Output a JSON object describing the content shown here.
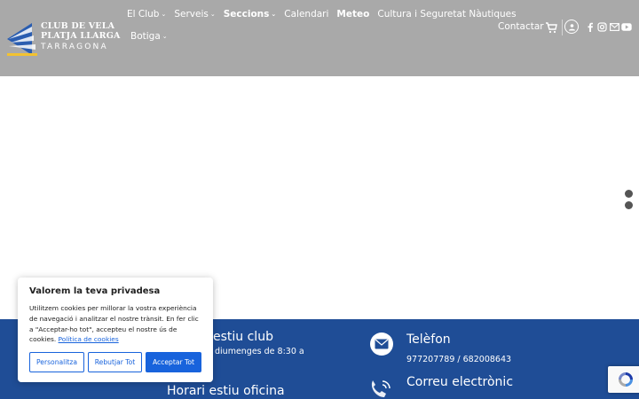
{
  "logo": {
    "line1": "CLUB DE VELA",
    "line2": "PLATJA LLARGA",
    "line3": "TARRAGONA"
  },
  "nav": {
    "row1": [
      {
        "label": "El Club",
        "dropdown": true
      },
      {
        "label": "Serveis",
        "dropdown": true
      },
      {
        "label": "Seccions",
        "dropdown": true
      },
      {
        "label": "Calendari",
        "dropdown": false
      },
      {
        "label": "Meteo",
        "dropdown": false
      },
      {
        "label": "Cultura i Seguretat Nàutiques",
        "dropdown": false
      }
    ],
    "row2": [
      {
        "label": "Botiga",
        "dropdown": true
      }
    ]
  },
  "header": {
    "contact_label": "Contactar",
    "icons": [
      "cart-icon",
      "user-icon",
      "facebook-icon",
      "instagram-icon",
      "email-icon",
      "youtube-icon"
    ]
  },
  "footer": {
    "col1_title": "estiu club",
    "col1_text": "diumenges de 8:30 a",
    "col1_title2": "Horari estiu oficina",
    "phone_title": "Telèfon",
    "phone_value": "977207789 / 682008643",
    "email_title": "Correu electrònic"
  },
  "cookie_banner": {
    "title": "Valorem la teva privadesa",
    "body": "Utilitzem cookies per millorar la vostra experiència de navegació i analitzar el nostre trànsit. En fer clic a \"Acceptar-ho tot\", accepteu el nostre ús de cookies.",
    "policy_link": "Política de cookies",
    "btn_customize": "Personalitza",
    "btn_reject": "Rebutjar Tot",
    "btn_accept": "Acceptar Tot"
  },
  "colors": {
    "header_bg": "#a9a9a9",
    "footer_bg": "#1f4d96",
    "cookie_accent": "#1863dc"
  }
}
